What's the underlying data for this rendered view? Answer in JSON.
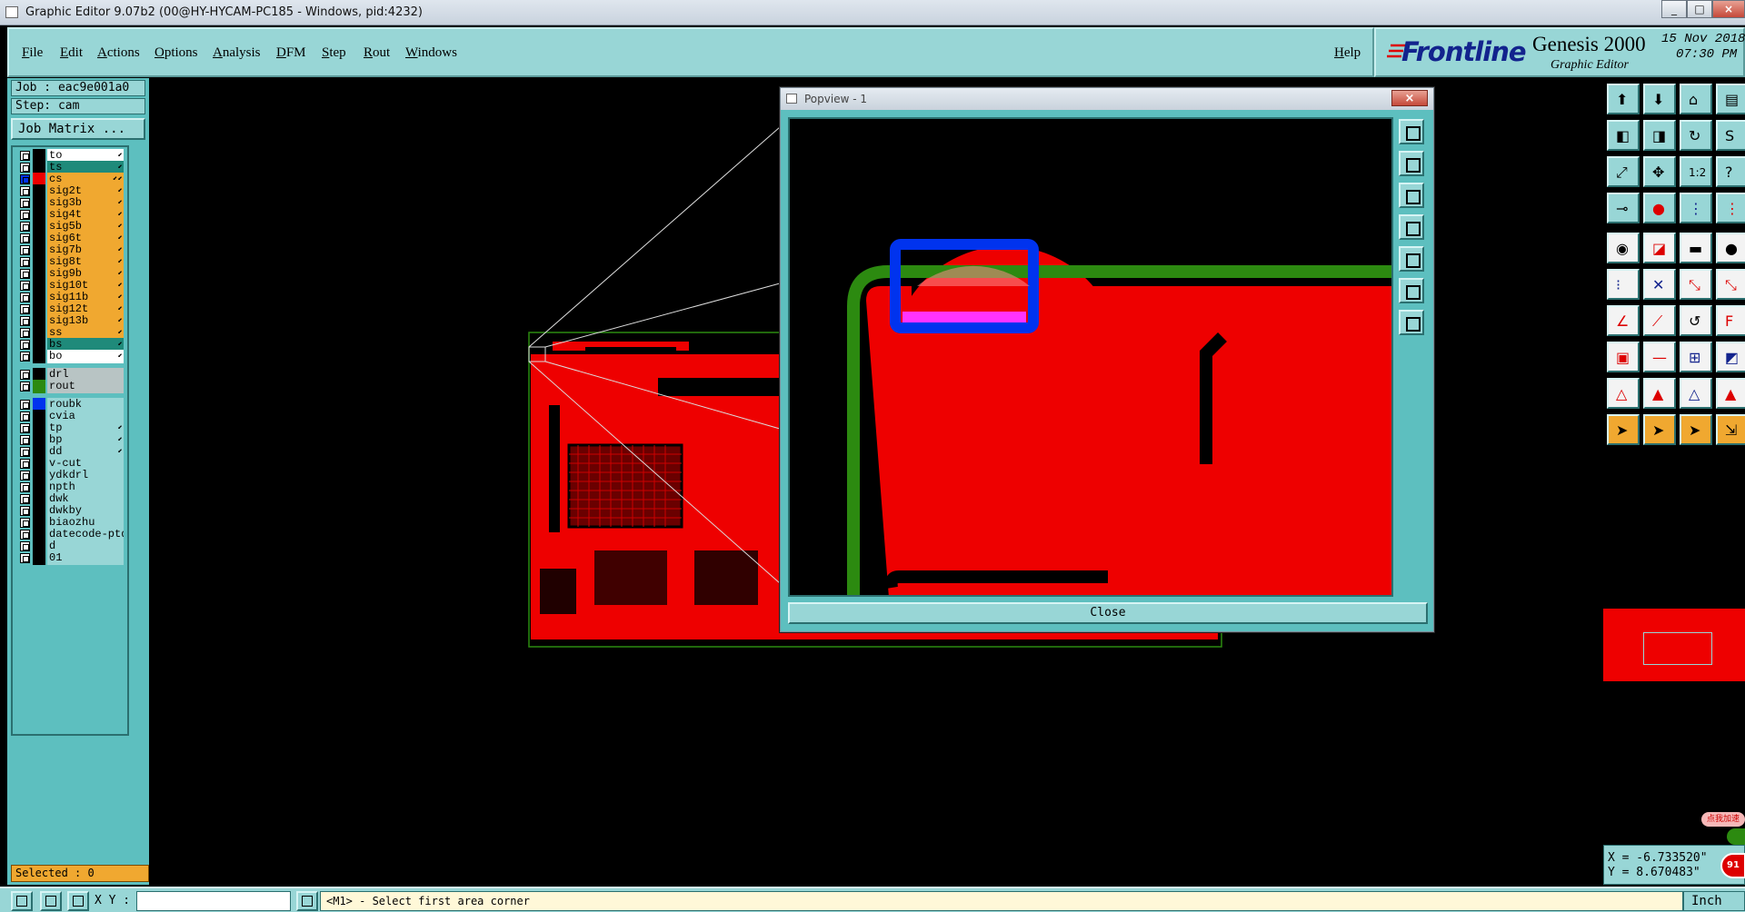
{
  "window": {
    "title": "Graphic Editor 9.07b2 (00@HY-HYCAM-PC185 - Windows, pid:4232)",
    "buttons": [
      "_",
      "□",
      "×"
    ]
  },
  "menubar": {
    "items": [
      "File",
      "Edit",
      "Actions",
      "Options",
      "Analysis",
      "DFM",
      "Step",
      "Rout",
      "Windows"
    ],
    "help": "Help"
  },
  "brand": {
    "logo": "Frontline",
    "product": "Genesis 2000",
    "subtitle": "Graphic Editor",
    "date": "15 Nov 2018",
    "time": "07:30 PM"
  },
  "job": {
    "job_label": "Job : eac9e001a0",
    "step_label": "Step: cam",
    "matrix_button": "Job Matrix ..."
  },
  "layers": [
    {
      "name": "to",
      "color": "#ffffff",
      "swatch": "#000000",
      "flag": "⬋"
    },
    {
      "name": "ts",
      "color": "#1f8a7a",
      "swatch": "#000000",
      "flag": "⬋"
    },
    {
      "name": "cs",
      "color": "#f0a830",
      "swatch": "#ee0000",
      "flag": "⬋⬋",
      "active": true
    },
    {
      "name": "sig2t",
      "color": "#f0a830",
      "swatch": "#000000",
      "flag": "⬋"
    },
    {
      "name": "sig3b",
      "color": "#f0a830",
      "swatch": "#000000",
      "flag": "⬋"
    },
    {
      "name": "sig4t",
      "color": "#f0a830",
      "swatch": "#000000",
      "flag": "⬋"
    },
    {
      "name": "sig5b",
      "color": "#f0a830",
      "swatch": "#000000",
      "flag": "⬋"
    },
    {
      "name": "sig6t",
      "color": "#f0a830",
      "swatch": "#000000",
      "flag": "⬋"
    },
    {
      "name": "sig7b",
      "color": "#f0a830",
      "swatch": "#000000",
      "flag": "⬋"
    },
    {
      "name": "sig8t",
      "color": "#f0a830",
      "swatch": "#000000",
      "flag": "⬋"
    },
    {
      "name": "sig9b",
      "color": "#f0a830",
      "swatch": "#000000",
      "flag": "⬋"
    },
    {
      "name": "sig10t",
      "color": "#f0a830",
      "swatch": "#000000",
      "flag": "⬋"
    },
    {
      "name": "sig11b",
      "color": "#f0a830",
      "swatch": "#000000",
      "flag": "⬋"
    },
    {
      "name": "sig12t",
      "color": "#f0a830",
      "swatch": "#000000",
      "flag": "⬋"
    },
    {
      "name": "sig13b",
      "color": "#f0a830",
      "swatch": "#000000",
      "flag": "⬋"
    },
    {
      "name": "ss",
      "color": "#f0a830",
      "swatch": "#000000",
      "flag": "⬋"
    },
    {
      "name": "bs",
      "color": "#1f8a7a",
      "swatch": "#000000",
      "flag": "⬋"
    },
    {
      "name": "bo",
      "color": "#ffffff",
      "swatch": "#000000",
      "flag": "⬋"
    },
    {
      "name": "drl",
      "color": "#b8c4c4",
      "swatch": "#000000",
      "flag": "",
      "gap": true
    },
    {
      "name": "rout",
      "color": "#b8c4c4",
      "swatch": "#2c8a10",
      "flag": ""
    },
    {
      "name": "roubk",
      "color": "#98d6d6",
      "swatch": "#0033ee",
      "flag": "",
      "gap": true
    },
    {
      "name": "cvia",
      "color": "#98d6d6",
      "swatch": "#000000",
      "flag": ""
    },
    {
      "name": "tp",
      "color": "#98d6d6",
      "swatch": "#000000",
      "flag": "⬋"
    },
    {
      "name": "bp",
      "color": "#98d6d6",
      "swatch": "#000000",
      "flag": "⬋"
    },
    {
      "name": "dd",
      "color": "#98d6d6",
      "swatch": "#000000",
      "flag": "⬋"
    },
    {
      "name": "v-cut",
      "color": "#98d6d6",
      "swatch": "#000000",
      "flag": ""
    },
    {
      "name": "ydkdrl",
      "color": "#98d6d6",
      "swatch": "#000000",
      "flag": ""
    },
    {
      "name": "npth",
      "color": "#98d6d6",
      "swatch": "#000000",
      "flag": ""
    },
    {
      "name": "dwk",
      "color": "#98d6d6",
      "swatch": "#000000",
      "flag": ""
    },
    {
      "name": "dwkby",
      "color": "#98d6d6",
      "swatch": "#000000",
      "flag": ""
    },
    {
      "name": "biaozhu",
      "color": "#98d6d6",
      "swatch": "#000000",
      "flag": ""
    },
    {
      "name": "datecode-ptd",
      "color": "#98d6d6",
      "swatch": "#000000",
      "flag": ""
    },
    {
      "name": "d",
      "color": "#98d6d6",
      "swatch": "#000000",
      "flag": ""
    },
    {
      "name": "01",
      "color": "#98d6d6",
      "swatch": "#000000",
      "flag": ""
    }
  ],
  "selected": "Selected : 0",
  "popview": {
    "title": "Popview - 1",
    "close_x": "×",
    "close_button": "Close"
  },
  "overview_badge": "点我加速",
  "overview_badge_num": "91",
  "coords": {
    "x": "X = -6.733520\"",
    "y": "Y = 8.670483\""
  },
  "status": {
    "xy_label": "X Y :",
    "xy_value": "",
    "message": "<M1> - Select first area corner",
    "units": "Inch"
  },
  "colors": {
    "teal_bg": "#98d6d6",
    "panel_dark": "#5dbfbf",
    "copper": "#ff0000",
    "rout": "#2c8a10",
    "roubk": "#0033ee",
    "logo_blue": "#12238d",
    "selected_orange": "#f0a830"
  }
}
